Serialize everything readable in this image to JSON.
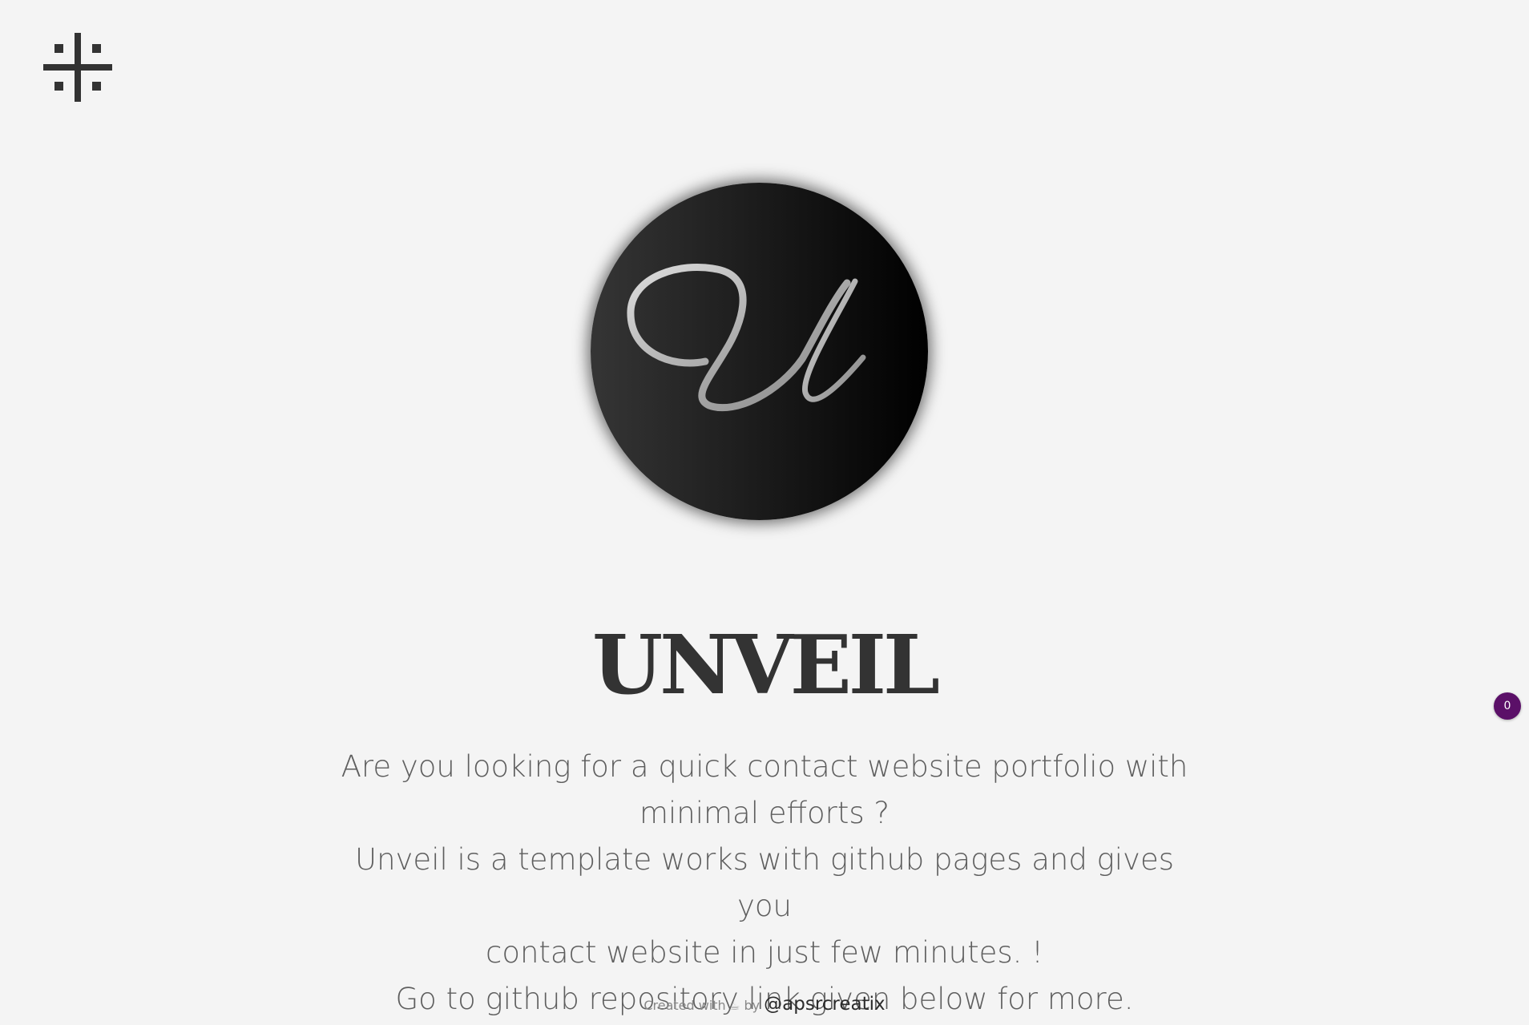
{
  "menu": {
    "icon": "grid-hash-icon"
  },
  "avatar": {
    "icon": "script-u-logo"
  },
  "hero": {
    "title": "UNVEIL",
    "lines": [
      "Are you looking for a quick contact website portfolio with",
      "minimal efforts ?",
      "Unveil is a template works with github pages and gives you",
      "contact website in just few minutes. !",
      "Go to github repository link given below for more."
    ]
  },
  "footer": {
    "created_with": "Created with",
    "coffee": "☕",
    "by": "by",
    "handle": "@apsrcreatix"
  },
  "badge": {
    "count": "0"
  },
  "colors": {
    "background": "#f4f4f4",
    "title": "#333333",
    "text": "#5e5e5e",
    "badge": "#5b1068"
  }
}
